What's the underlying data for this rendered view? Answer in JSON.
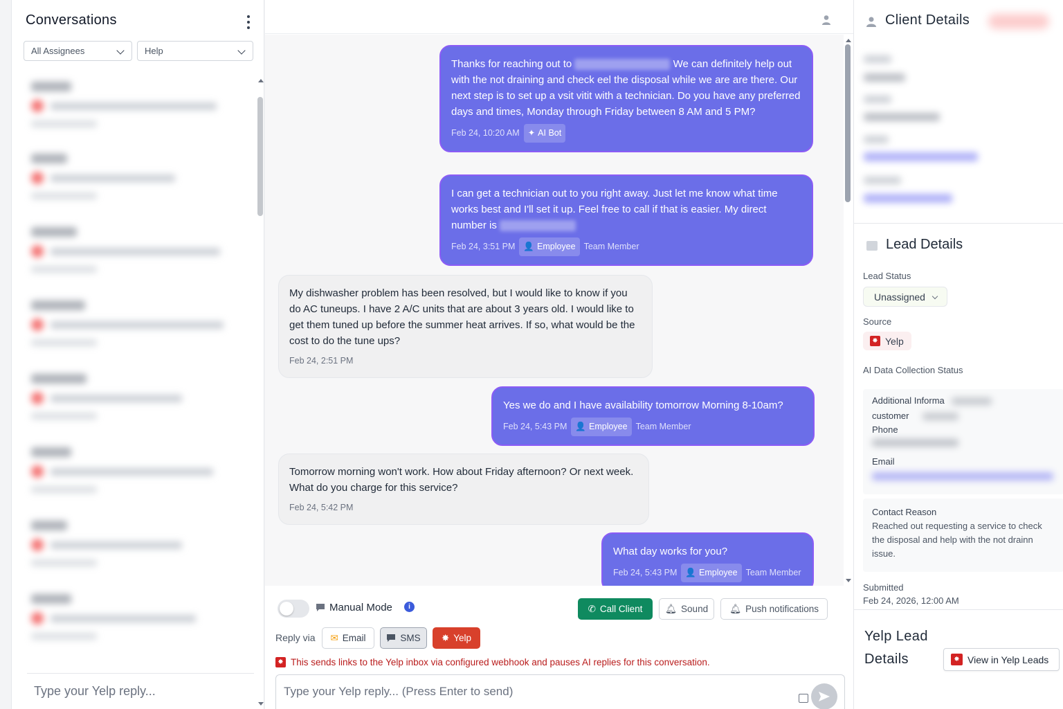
{
  "conversations": {
    "title": "Conversations",
    "filter_assignees": "All Assignees",
    "filter_help": "Help",
    "reply_placeholder": "Type your Yelp reply..."
  },
  "header": {
    "user_icon": "user-icon"
  },
  "messages": [
    {
      "direction": "out",
      "text_a": "Thanks for reaching out to ",
      "text_b": " We can definitely help out with the not draining and check eel the disposal while we are are there. Our next step is to set up a vsit vitit with a technician. Do you have any preferred days and times, Monday through Friday between 8 AM and 5 PM?",
      "time": "Feb 24, 10:20 AM",
      "badge": "AI Bot"
    },
    {
      "direction": "out",
      "text_a": "I can get a technician out to you right away. Just let me know what time works best and I'll set it up. Feel free to call if that is easier. My direct number is ",
      "time": "Feb 24, 3:51 PM",
      "badge": "Employee",
      "role": "Team Member"
    },
    {
      "direction": "in",
      "text": "My dishwasher problem has been resolved, but I would like to know if you do AC tuneups. I have 2 A/C units that are about 3 years old. I would like to get them tuned up before the summer heat arrives. If so, what would be the cost to do the tune ups?",
      "time": "Feb 24, 2:51 PM"
    },
    {
      "direction": "out",
      "text": "Yes we do and I have availability tomorrow Morning 8-10am?",
      "time": "Feb 24, 5:43 PM",
      "badge": "Employee",
      "role": "Team Member"
    },
    {
      "direction": "in",
      "text": "Tomorrow morning won't work. How about Friday afternoon? Or next week. What do you charge for this service?",
      "time": "Feb 24, 5:42 PM"
    },
    {
      "direction": "out",
      "text": "What day works for you?",
      "time": "Feb 24, 5:43 PM",
      "badge": "Employee",
      "role": "Team Member"
    }
  ],
  "controls": {
    "manual_mode": "Manual Mode",
    "call_client": "Call Client",
    "sound": "Sound",
    "push_notifications": "Push notifications",
    "reply_via": "Reply via",
    "email": "Email",
    "sms": "SMS",
    "yelp": "Yelp",
    "warning": "This sends links to the Yelp inbox via configured webhook and pauses AI replies for this conversation.",
    "composer_placeholder": "Type your Yelp reply... (Press Enter to send)"
  },
  "client_details": {
    "title": "Client Details"
  },
  "lead_details": {
    "title": "Lead Details",
    "status_label": "Lead Status",
    "status_value": "Unassigned",
    "source_label": "Source",
    "source_value": "Yelp",
    "ai_label": "AI Data Collection Status",
    "ai_additional": "Additional Informa",
    "ai_customer": "customer",
    "ai_phone": "Phone",
    "ai_email": "Email",
    "contact_reason_label": "Contact Reason",
    "contact_reason_text": "Reached out requesting a service to check the disposal and help with the not drainn issue.",
    "submitted_label": "Submitted",
    "submitted_value": "Feb 24, 2026, 12:00 AM"
  },
  "yelp_lead": {
    "title_line1": "Yelp Lead",
    "title_line2": "Details",
    "button": "View in Yelp Leads"
  },
  "colors": {
    "outgoing_bubble": "#6b6ee8",
    "call_button": "#0f8a5f",
    "yelp_button": "#d8402b",
    "warning_text": "#b91c1c"
  }
}
